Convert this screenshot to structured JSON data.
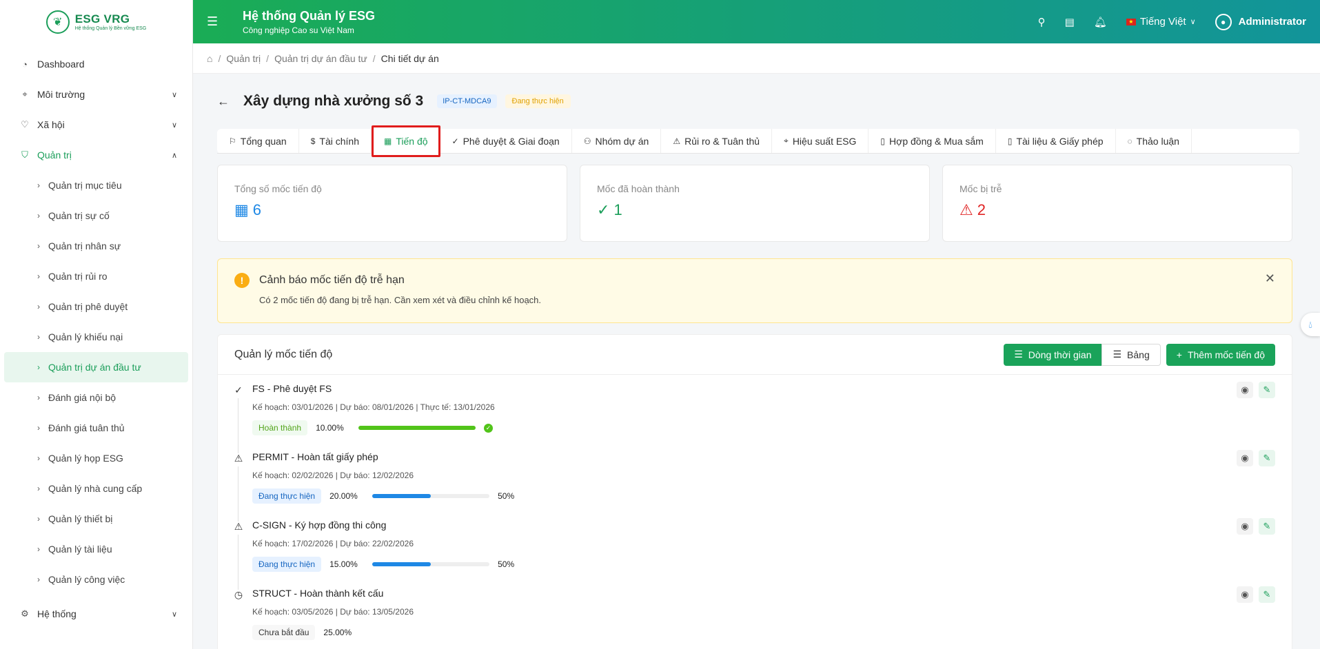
{
  "app": {
    "logo_title": "ESG VRG",
    "logo_sub": "Hệ thống Quản lý Bền vững ESG",
    "header_title": "Hệ thống Quản lý ESG",
    "header_subtitle": "Công nghiệp Cao su Việt Nam",
    "language": "Tiếng Việt",
    "user": "Administrator"
  },
  "sidebar": {
    "items": [
      {
        "label": "Dashboard",
        "icon": "dashboard-icon"
      },
      {
        "label": "Môi trường",
        "icon": "location-icon"
      },
      {
        "label": "Xã hội",
        "icon": "heart-icon"
      },
      {
        "label": "Quản trị",
        "icon": "shield-check-icon"
      }
    ],
    "sub_items": [
      "Quản trị mục tiêu",
      "Quản trị sự cố",
      "Quản trị nhân sự",
      "Quản trị rủi ro",
      "Quản trị phê duyệt",
      "Quản lý khiếu nại",
      "Quản trị dự án đầu tư",
      "Đánh giá nội bộ",
      "Đánh giá tuân thủ",
      "Quản lý họp ESG",
      "Quản lý nhà cung cấp",
      "Quản lý thiết bị",
      "Quản lý tài liệu",
      "Quản lý công việc"
    ],
    "system": "Hệ thống"
  },
  "breadcrumb": [
    "Quản trị",
    "Quản trị dự án đầu tư",
    "Chi tiết dự án"
  ],
  "project": {
    "title": "Xây dựng nhà xưởng số 3",
    "code": "IP-CT-MDCA9",
    "status": "Đang thực hiện"
  },
  "tabs": [
    {
      "label": "Tổng quan",
      "icon": "flag-icon"
    },
    {
      "label": "Tài chính",
      "icon": "dollar-icon"
    },
    {
      "label": "Tiến độ",
      "icon": "calendar-icon"
    },
    {
      "label": "Phê duyệt & Giai đoạn",
      "icon": "check-circle-icon"
    },
    {
      "label": "Nhóm dự án",
      "icon": "team-icon"
    },
    {
      "label": "Rủi ro & Tuân thủ",
      "icon": "warning-icon"
    },
    {
      "label": "Hiệu suất ESG",
      "icon": "location-icon"
    },
    {
      "label": "Hợp đồng & Mua sắm",
      "icon": "document-icon"
    },
    {
      "label": "Tài liệu & Giấy phép",
      "icon": "file-icon"
    },
    {
      "label": "Thảo luận",
      "icon": "chat-icon"
    }
  ],
  "stats": {
    "total_label": "Tổng số mốc tiến độ",
    "total_value": "6",
    "done_label": "Mốc đã hoàn thành",
    "done_value": "1",
    "late_label": "Mốc bị trễ",
    "late_value": "2"
  },
  "alert": {
    "title": "Cảnh báo mốc tiến độ trễ hạn",
    "desc": "Có 2 mốc tiến độ đang bị trễ hạn. Cần xem xét và điều chỉnh kế hoạch."
  },
  "milestones_panel": {
    "title": "Quản lý mốc tiến độ",
    "timeline_btn": "Dòng thời gian",
    "table_btn": "Bảng",
    "add_btn": "Thêm mốc tiến độ"
  },
  "milestones": [
    {
      "name": "FS - Phê duyệt FS",
      "meta": "Kế hoạch: 03/01/2026 | Dự báo: 08/01/2026 | Thực tế: 13/01/2026",
      "status": "Hoàn thành",
      "weight": "10.00%",
      "progress": 100,
      "progress_label": ""
    },
    {
      "name": "PERMIT - Hoàn tất giấy phép",
      "meta": "Kế hoạch: 02/02/2026 | Dự báo: 12/02/2026",
      "status": "Đang thực hiện",
      "weight": "20.00%",
      "progress": 50,
      "progress_label": "50%"
    },
    {
      "name": "C-SIGN - Ký hợp đồng thi công",
      "meta": "Kế hoạch: 17/02/2026 | Dự báo: 22/02/2026",
      "status": "Đang thực hiện",
      "weight": "15.00%",
      "progress": 50,
      "progress_label": "50%"
    },
    {
      "name": "STRUCT - Hoàn thành kết cấu",
      "meta": "Kế hoạch: 03/05/2026 | Dự báo: 13/05/2026",
      "status": "Chưa bắt đầu",
      "weight": "25.00%",
      "progress": 0,
      "progress_label": ""
    }
  ],
  "colors": {
    "brand_green": "#1aa35a",
    "header_gradient_end": "#12949a",
    "active_tab_border": "#e01c1c"
  }
}
